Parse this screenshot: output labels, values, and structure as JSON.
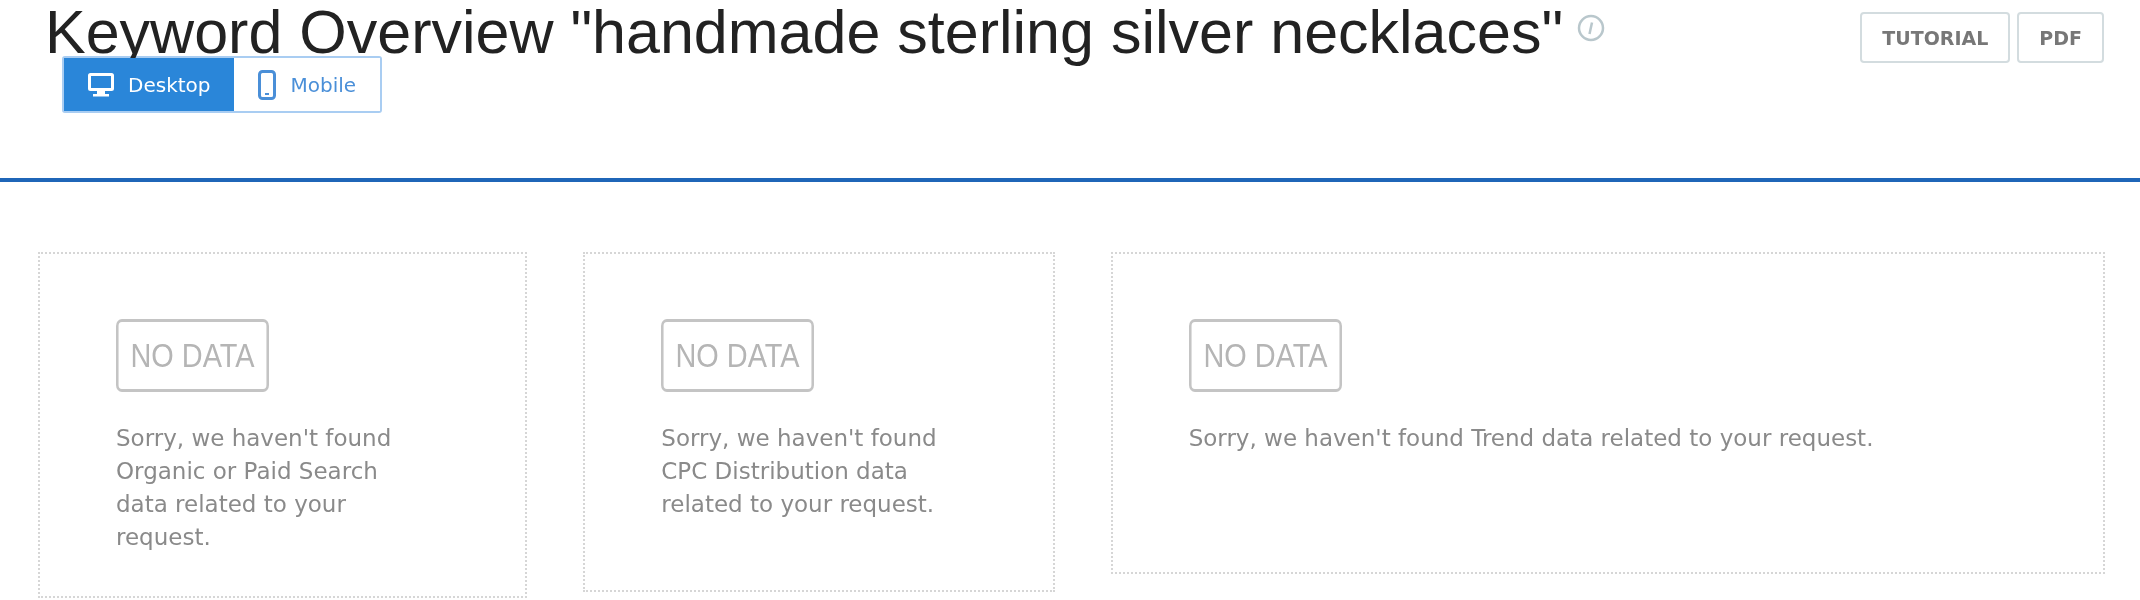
{
  "title": "Keyword Overview \"handmade sterling silver necklaces\"",
  "device_toggle": [
    {
      "label": "Desktop",
      "kind": "desktop",
      "selected": true
    },
    {
      "label": "Mobile",
      "kind": "mobile",
      "selected": false
    }
  ],
  "buttons": [
    "TUTORIAL",
    "PDF"
  ],
  "cards": [
    {
      "badge": "NO DATA",
      "message": "Sorry, we haven't found Organic or Paid Search data related to your request."
    },
    {
      "badge": "NO DATA",
      "message": "Sorry, we haven't found CPC Distribution data related to your request."
    },
    {
      "badge": "NO DATA",
      "message": "Sorry, we haven't found Trend data related to your request."
    }
  ]
}
